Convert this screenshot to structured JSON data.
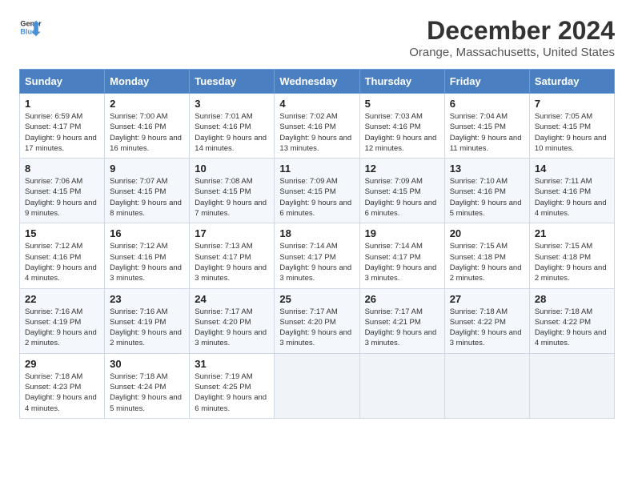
{
  "header": {
    "logo_line1": "General",
    "logo_line2": "Blue",
    "month": "December 2024",
    "location": "Orange, Massachusetts, United States"
  },
  "days_of_week": [
    "Sunday",
    "Monday",
    "Tuesday",
    "Wednesday",
    "Thursday",
    "Friday",
    "Saturday"
  ],
  "weeks": [
    [
      {
        "num": "1",
        "rise": "Sunrise: 6:59 AM",
        "set": "Sunset: 4:17 PM",
        "daylight": "Daylight: 9 hours and 17 minutes."
      },
      {
        "num": "2",
        "rise": "Sunrise: 7:00 AM",
        "set": "Sunset: 4:16 PM",
        "daylight": "Daylight: 9 hours and 16 minutes."
      },
      {
        "num": "3",
        "rise": "Sunrise: 7:01 AM",
        "set": "Sunset: 4:16 PM",
        "daylight": "Daylight: 9 hours and 14 minutes."
      },
      {
        "num": "4",
        "rise": "Sunrise: 7:02 AM",
        "set": "Sunset: 4:16 PM",
        "daylight": "Daylight: 9 hours and 13 minutes."
      },
      {
        "num": "5",
        "rise": "Sunrise: 7:03 AM",
        "set": "Sunset: 4:16 PM",
        "daylight": "Daylight: 9 hours and 12 minutes."
      },
      {
        "num": "6",
        "rise": "Sunrise: 7:04 AM",
        "set": "Sunset: 4:15 PM",
        "daylight": "Daylight: 9 hours and 11 minutes."
      },
      {
        "num": "7",
        "rise": "Sunrise: 7:05 AM",
        "set": "Sunset: 4:15 PM",
        "daylight": "Daylight: 9 hours and 10 minutes."
      }
    ],
    [
      {
        "num": "8",
        "rise": "Sunrise: 7:06 AM",
        "set": "Sunset: 4:15 PM",
        "daylight": "Daylight: 9 hours and 9 minutes."
      },
      {
        "num": "9",
        "rise": "Sunrise: 7:07 AM",
        "set": "Sunset: 4:15 PM",
        "daylight": "Daylight: 9 hours and 8 minutes."
      },
      {
        "num": "10",
        "rise": "Sunrise: 7:08 AM",
        "set": "Sunset: 4:15 PM",
        "daylight": "Daylight: 9 hours and 7 minutes."
      },
      {
        "num": "11",
        "rise": "Sunrise: 7:09 AM",
        "set": "Sunset: 4:15 PM",
        "daylight": "Daylight: 9 hours and 6 minutes."
      },
      {
        "num": "12",
        "rise": "Sunrise: 7:09 AM",
        "set": "Sunset: 4:15 PM",
        "daylight": "Daylight: 9 hours and 6 minutes."
      },
      {
        "num": "13",
        "rise": "Sunrise: 7:10 AM",
        "set": "Sunset: 4:16 PM",
        "daylight": "Daylight: 9 hours and 5 minutes."
      },
      {
        "num": "14",
        "rise": "Sunrise: 7:11 AM",
        "set": "Sunset: 4:16 PM",
        "daylight": "Daylight: 9 hours and 4 minutes."
      }
    ],
    [
      {
        "num": "15",
        "rise": "Sunrise: 7:12 AM",
        "set": "Sunset: 4:16 PM",
        "daylight": "Daylight: 9 hours and 4 minutes."
      },
      {
        "num": "16",
        "rise": "Sunrise: 7:12 AM",
        "set": "Sunset: 4:16 PM",
        "daylight": "Daylight: 9 hours and 3 minutes."
      },
      {
        "num": "17",
        "rise": "Sunrise: 7:13 AM",
        "set": "Sunset: 4:17 PM",
        "daylight": "Daylight: 9 hours and 3 minutes."
      },
      {
        "num": "18",
        "rise": "Sunrise: 7:14 AM",
        "set": "Sunset: 4:17 PM",
        "daylight": "Daylight: 9 hours and 3 minutes."
      },
      {
        "num": "19",
        "rise": "Sunrise: 7:14 AM",
        "set": "Sunset: 4:17 PM",
        "daylight": "Daylight: 9 hours and 3 minutes."
      },
      {
        "num": "20",
        "rise": "Sunrise: 7:15 AM",
        "set": "Sunset: 4:18 PM",
        "daylight": "Daylight: 9 hours and 2 minutes."
      },
      {
        "num": "21",
        "rise": "Sunrise: 7:15 AM",
        "set": "Sunset: 4:18 PM",
        "daylight": "Daylight: 9 hours and 2 minutes."
      }
    ],
    [
      {
        "num": "22",
        "rise": "Sunrise: 7:16 AM",
        "set": "Sunset: 4:19 PM",
        "daylight": "Daylight: 9 hours and 2 minutes."
      },
      {
        "num": "23",
        "rise": "Sunrise: 7:16 AM",
        "set": "Sunset: 4:19 PM",
        "daylight": "Daylight: 9 hours and 2 minutes."
      },
      {
        "num": "24",
        "rise": "Sunrise: 7:17 AM",
        "set": "Sunset: 4:20 PM",
        "daylight": "Daylight: 9 hours and 3 minutes."
      },
      {
        "num": "25",
        "rise": "Sunrise: 7:17 AM",
        "set": "Sunset: 4:20 PM",
        "daylight": "Daylight: 9 hours and 3 minutes."
      },
      {
        "num": "26",
        "rise": "Sunrise: 7:17 AM",
        "set": "Sunset: 4:21 PM",
        "daylight": "Daylight: 9 hours and 3 minutes."
      },
      {
        "num": "27",
        "rise": "Sunrise: 7:18 AM",
        "set": "Sunset: 4:22 PM",
        "daylight": "Daylight: 9 hours and 3 minutes."
      },
      {
        "num": "28",
        "rise": "Sunrise: 7:18 AM",
        "set": "Sunset: 4:22 PM",
        "daylight": "Daylight: 9 hours and 4 minutes."
      }
    ],
    [
      {
        "num": "29",
        "rise": "Sunrise: 7:18 AM",
        "set": "Sunset: 4:23 PM",
        "daylight": "Daylight: 9 hours and 4 minutes."
      },
      {
        "num": "30",
        "rise": "Sunrise: 7:18 AM",
        "set": "Sunset: 4:24 PM",
        "daylight": "Daylight: 9 hours and 5 minutes."
      },
      {
        "num": "31",
        "rise": "Sunrise: 7:19 AM",
        "set": "Sunset: 4:25 PM",
        "daylight": "Daylight: 9 hours and 6 minutes."
      },
      null,
      null,
      null,
      null
    ]
  ]
}
